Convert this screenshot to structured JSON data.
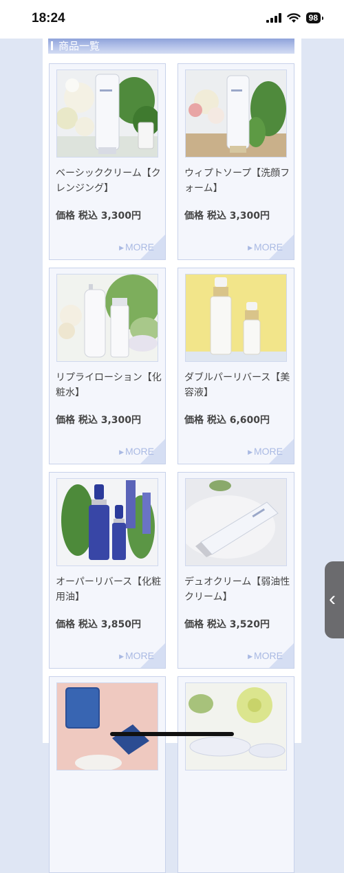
{
  "status_bar": {
    "time": "18:24",
    "battery": "98",
    "icons": [
      "cellular-signal-icon",
      "wifi-icon",
      "battery-icon"
    ]
  },
  "section": {
    "title": "商品一覧"
  },
  "products": [
    {
      "name": "ベーシッククリーム【クレンジング】",
      "price": "価格 税込 3,300円",
      "more": "MORE",
      "icon": "cream-tube-flowers-image"
    },
    {
      "name": "ウィプトソープ【洗顔フォーム】",
      "price": "価格 税込 3,300円",
      "more": "MORE",
      "icon": "soap-tube-flowers-image"
    },
    {
      "name": "リプライローション【化粧水】",
      "price": "価格 税込 3,300円",
      "more": "MORE",
      "icon": "lotion-bottles-image"
    },
    {
      "name": "ダブルパーリバース【美容液】",
      "price": "価格 税込 6,600円",
      "more": "MORE",
      "icon": "serum-bottles-image"
    },
    {
      "name": "オーパーリバース【化粧用油】",
      "price": "価格 税込 3,850円",
      "more": "MORE",
      "icon": "oil-bottles-image"
    },
    {
      "name": "デュオクリーム【弱油性クリーム】",
      "price": "価格 税込 3,520円",
      "more": "MORE",
      "icon": "cream-tube-towel-image"
    },
    {
      "name": "",
      "price": "",
      "more": "",
      "icon": "compact-case-image"
    },
    {
      "name": "",
      "price": "",
      "more": "",
      "icon": "powder-jar-image"
    }
  ],
  "colors": {
    "accent": "#8fa3da",
    "more_text": "#a9b9e3",
    "card_bg": "#f4f6fc",
    "page_bg": "#dfe6f4"
  }
}
